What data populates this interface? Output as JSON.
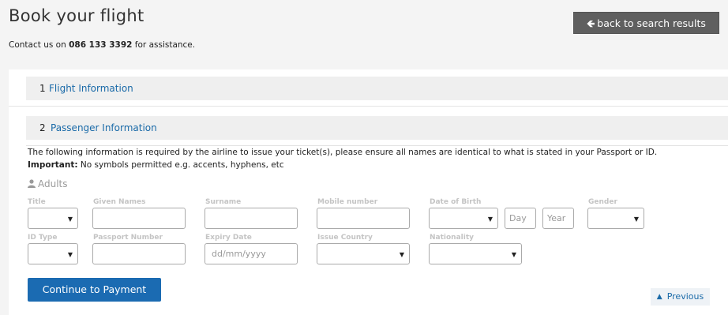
{
  "header": {
    "title": "Book your flight",
    "back_label": "back to search results",
    "contact_prefix": "Contact us on ",
    "contact_phone": "086 133 3392",
    "contact_suffix": " for assistance."
  },
  "steps": [
    {
      "number": "1",
      "title": "Flight Information"
    },
    {
      "number": "2",
      "title": "Passenger Information"
    }
  ],
  "passenger": {
    "info_text": "The following information is required by the airline to issue your ticket(s), please ensure all names are identical to what is stated in your Passport or ID.",
    "important_label": "Important:",
    "important_text": " No symbols permitted e.g. accents, hyphens, etc",
    "section_label": "Adults",
    "fields": {
      "title": {
        "label": "Title",
        "value": ""
      },
      "given_names": {
        "label": "Given Names",
        "value": ""
      },
      "surname": {
        "label": "Surname",
        "value": ""
      },
      "mobile": {
        "label": "Mobile number",
        "value": ""
      },
      "dob": {
        "label": "Date of Birth",
        "day_placeholder": "Day",
        "year_placeholder": "Year"
      },
      "gender": {
        "label": "Gender",
        "value": ""
      },
      "id_type": {
        "label": "ID Type",
        "value": ""
      },
      "passport": {
        "label": "Passport Number",
        "value": ""
      },
      "expiry": {
        "label": "Expiry Date",
        "placeholder": "dd/mm/yyyy"
      },
      "issue_country": {
        "label": "Issue Country",
        "value": ""
      },
      "nationality": {
        "label": "Nationality",
        "value": ""
      }
    }
  },
  "actions": {
    "continue_label": "Continue to Payment",
    "previous_label": "Previous"
  },
  "colors": {
    "accent": "#1b6bb2",
    "link": "#1a6aa8",
    "back_button": "#5f5f5f"
  }
}
